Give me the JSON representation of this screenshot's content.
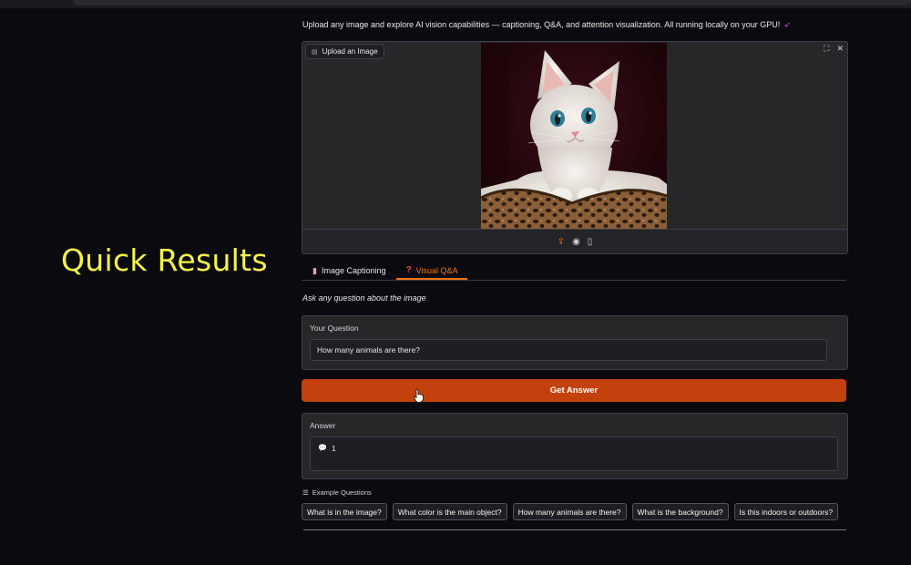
{
  "overlay": {
    "title": "Quick Results"
  },
  "description": "Upload any image and explore AI vision capabilities — captioning, Q&A, and attention visualization. All running locally on your GPU!",
  "image_panel": {
    "label": "Upload an Image",
    "image_subject": "white kitten in a leopard-print basket",
    "icons": [
      "image-icon",
      "fullscreen-icon",
      "close-icon",
      "upload-icon",
      "webcam-icon",
      "clipboard-icon"
    ]
  },
  "tabs": [
    {
      "label": "Image Captioning",
      "icon": "document-icon",
      "active": false
    },
    {
      "label": "Visual Q&A",
      "icon": "question-mark-icon",
      "active": true
    }
  ],
  "hint": "Ask any question about the image",
  "question": {
    "label": "Your Question",
    "value": "How many animals are there?"
  },
  "submit_label": "Get Answer",
  "answer": {
    "label": "Answer",
    "value": "1"
  },
  "examples": {
    "label": "Example Questions",
    "items": [
      "What is in the image?",
      "What color is the main object?",
      "How many animals are there?",
      "What is the background?",
      "Is this indoors or outdoors?"
    ]
  },
  "colors": {
    "accent": "#c2410c",
    "accent_text": "#f97316",
    "overlay_text": "#f4f44a",
    "background": "#0b0b0f",
    "panel": "#27272a"
  }
}
